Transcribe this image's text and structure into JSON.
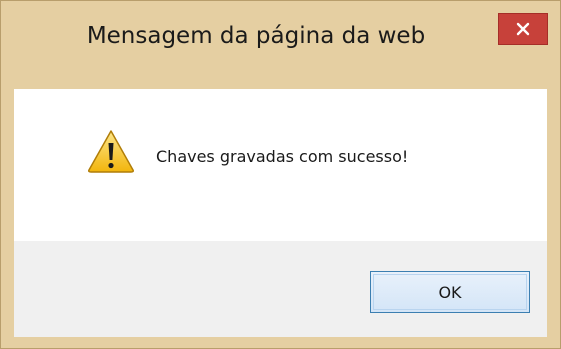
{
  "dialog": {
    "title": "Mensagem da página da web",
    "message": "Chaves gravadas com sucesso!",
    "ok_label": "OK",
    "icon": "warning-icon",
    "close_icon": "close-icon"
  },
  "colors": {
    "frame": "#e5cfa2",
    "close_button": "#c7413a",
    "content_bg": "#ffffff",
    "footer_bg": "#f0f0f0",
    "ok_border": "#3c7fb1",
    "warning_fill": "#f7c41f"
  }
}
